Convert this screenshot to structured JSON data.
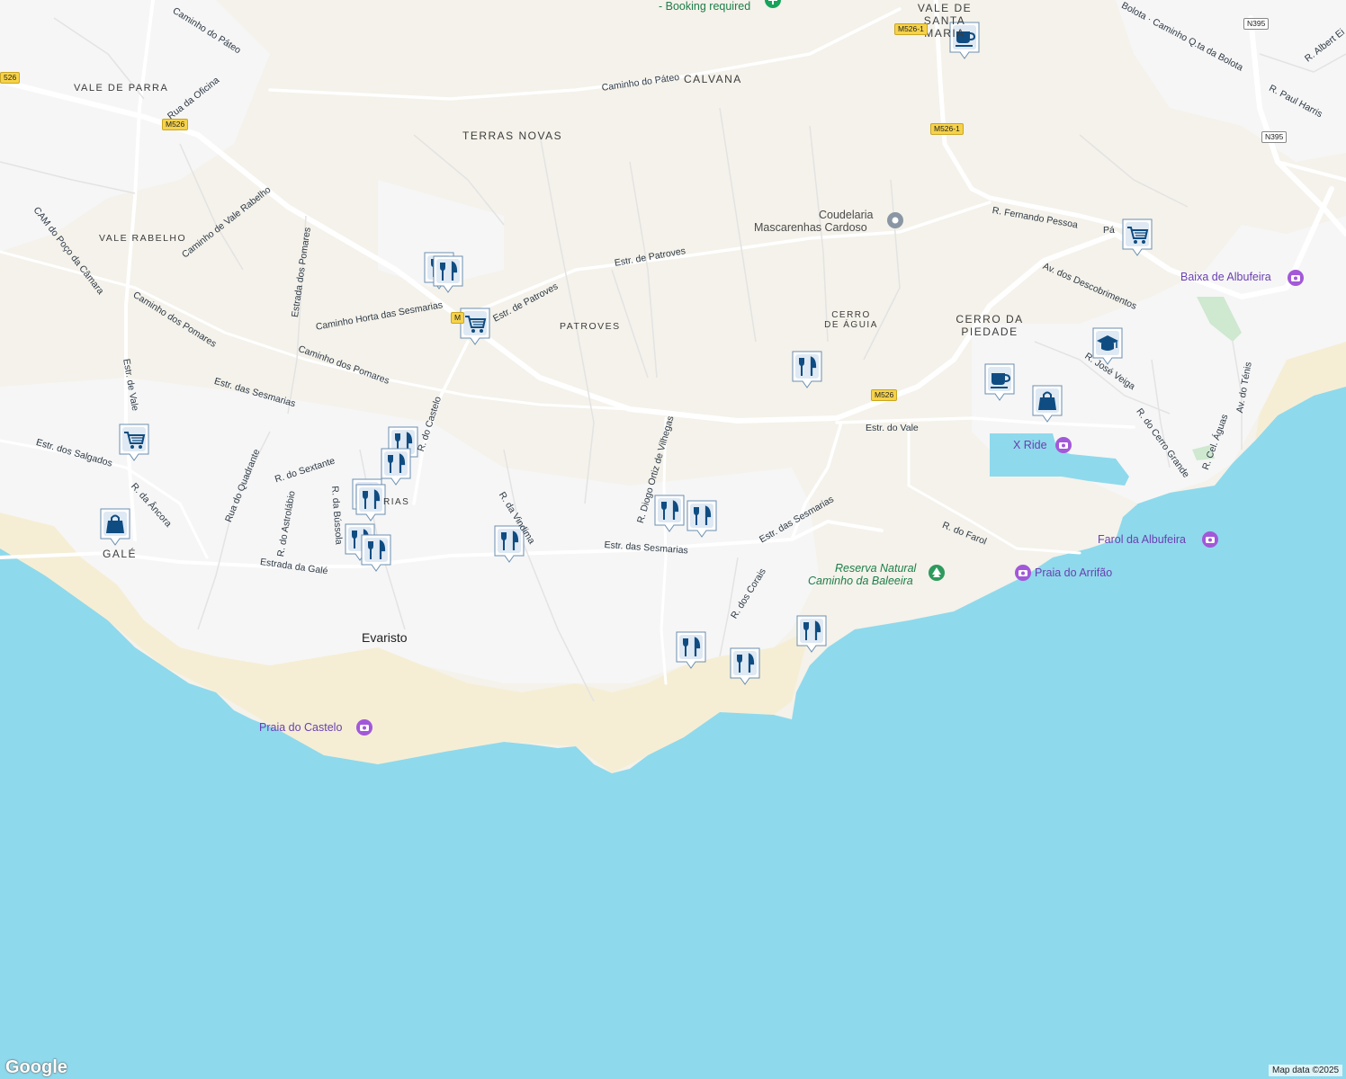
{
  "map": {
    "colors": {
      "sea": "#8fd9ec",
      "land": "#f4f2ea",
      "urban": "#f6f6f6",
      "beach": "#f5eed5",
      "road": "#ffffff",
      "marker": "#0f4c81",
      "poi": "#6a3fb0"
    },
    "areas": {
      "vale_santa_maria": "VALE DE SANTA MARIA",
      "calvana": "CALVANA",
      "vale_de_parra": "VALE DE PARRA",
      "terras_novas": "TERRAS NOVAS",
      "vale_rabelho": "VALE RABELHO",
      "patroves": "PATROVES",
      "cerro_de_aguia": "CERRO DE ÁGUIA",
      "cerro_da_piedade": "CERRO DA PIEDADE",
      "gale": "GALÉ",
      "sesmarias": "RIAS"
    },
    "towns": {
      "evaristo": "Evaristo"
    },
    "streets": {
      "caminho_do_pateo_top": "Caminho do Páteo",
      "caminho_do_pateo": "Caminho do Páteo",
      "rua_da_oficina": "Rua da Oficina",
      "camino_bolota": "Bolota · Caminho Q.ta da Bolota",
      "r_albert": "R. Albert Ei",
      "r_paul_harris": "R. Paul Harris",
      "caminho_vale_rabelho": "Caminho de Vale Rabelho",
      "cam_poco_camara": "CAM do Poço da Câmara",
      "estrada_pomares": "Estrada dos Pomares",
      "estr_patroves": "Estr. de Patroves",
      "estr_patroves_2": "Estr. de Patroves",
      "caminho_horta": "Caminho Horta das Sesmarias",
      "caminho_pomares": "Caminho dos Pomares",
      "caminho_pomares_2": "Caminho dos Pomares",
      "estr_sesmarias_w": "Estr. das Sesmarias",
      "estr_vale_w": "Estr. de Vale",
      "r_castelo": "R. do Castelo",
      "estr_salgados": "Estr. dos Salgados",
      "r_ancora": "R. da Âncora",
      "r_sextante": "R. do Sextante",
      "rua_quadrante": "Rua do Quadrante",
      "r_astrolabio": "R. do Astrolábio",
      "r_bussola": "R. da Bússola",
      "estrada_gale": "Estrada da Galé",
      "r_vindima": "R. da Vindima",
      "r_diogo": "R. Diogo Ortiz de Vilhegas",
      "estr_sesmarias": "Estr. das Sesmarias",
      "estr_sesmarias_2": "Estr. das Sesmarias",
      "estr_sesmarias_3": "Estr. das Sesmarias",
      "r_corais": "R. dos Corais",
      "estr_vale": "Estr. do Vale",
      "r_farol": "R. do Farol",
      "r_fernando_pessoa": "R. Fernando Pessoa",
      "av_descobrimentos": "Av. dos Descobrimentos",
      "r_veiga": "R. José Veiga",
      "r_cerro_grande": "R. do Cerro Grande",
      "r_cel_aguas": "R. Cel. Águas",
      "av_tenis": "Av. do Ténis",
      "pateo_right": "Pá"
    },
    "shields": {
      "m526_1a": "M526-1",
      "m526_1b": "M526-1",
      "m526_a": "M526",
      "m526_b": "M526",
      "m526_c": "M",
      "n395_a": "N395",
      "n395_b": "N395",
      "m526_left": "526"
    },
    "pois": {
      "booking": "- Booking required",
      "coudelaria_1": "Coudelaria",
      "coudelaria_2": "Mascarenhas Cardoso",
      "baixa": "Baixa de Albufeira",
      "x_ride": "X Ride",
      "farol": "Farol da Albufeira",
      "arrifao": "Praia do Arrifão",
      "reserva_1": "Reserva Natural",
      "reserva_2": "Caminho da Baleeira",
      "castelo": "Praia do Castelo"
    },
    "footer": {
      "logo": "Google",
      "attribution": "Map data ©2025"
    }
  }
}
